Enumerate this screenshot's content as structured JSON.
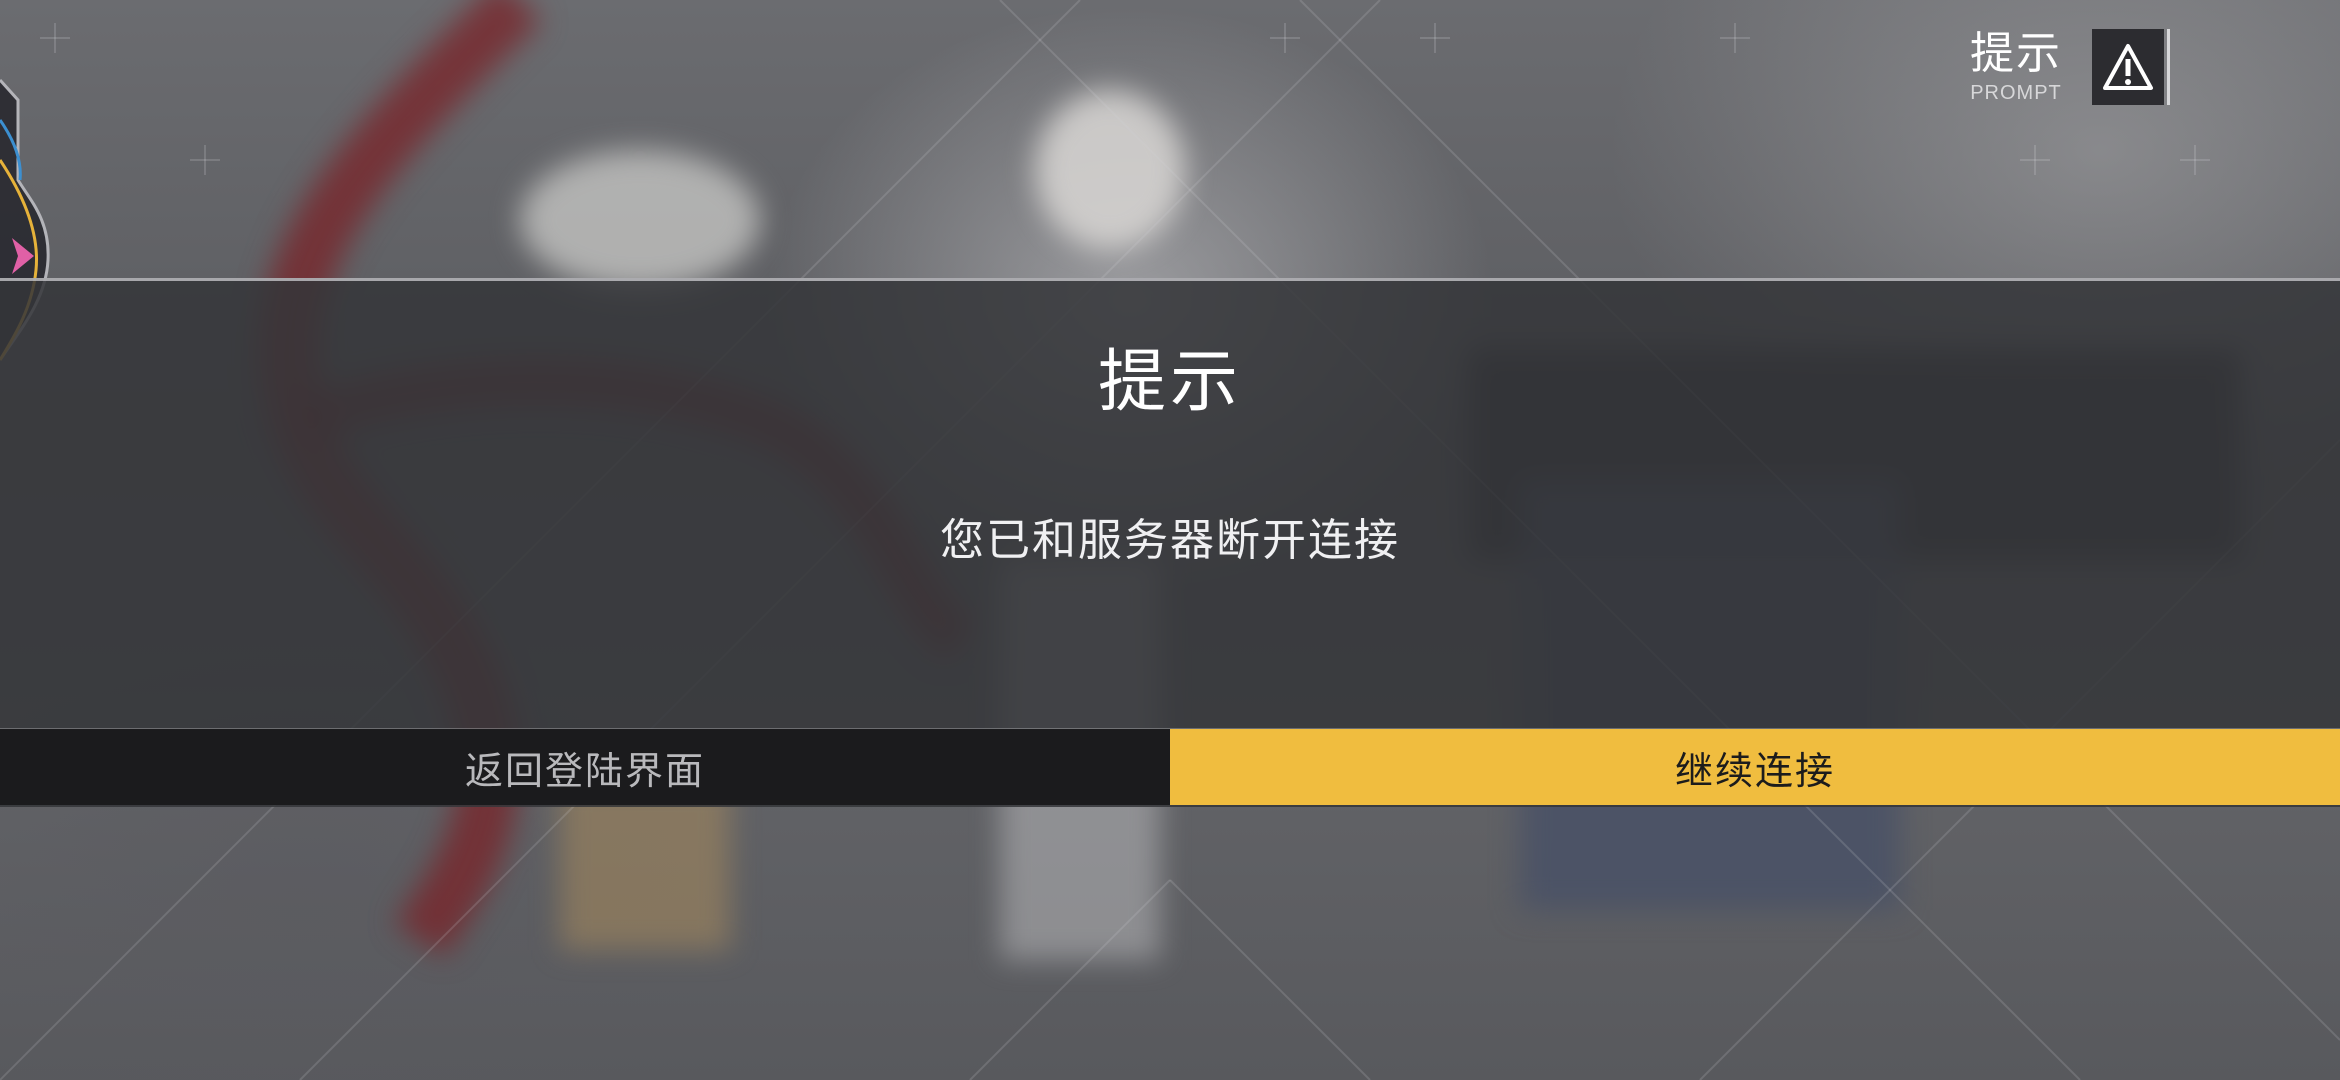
{
  "header": {
    "title": "提示",
    "subtitle": "PROMPT",
    "icon": "warning-icon"
  },
  "dialog": {
    "title": "提示",
    "message": "您已和服务器断开连接",
    "buttons": {
      "return_login": "返回登陆界面",
      "continue_connect": "继续连接"
    }
  },
  "colors": {
    "accent": "#f0bd3f",
    "dialog_bg": "#343539",
    "secondary_button_bg": "#1b1b1d"
  }
}
